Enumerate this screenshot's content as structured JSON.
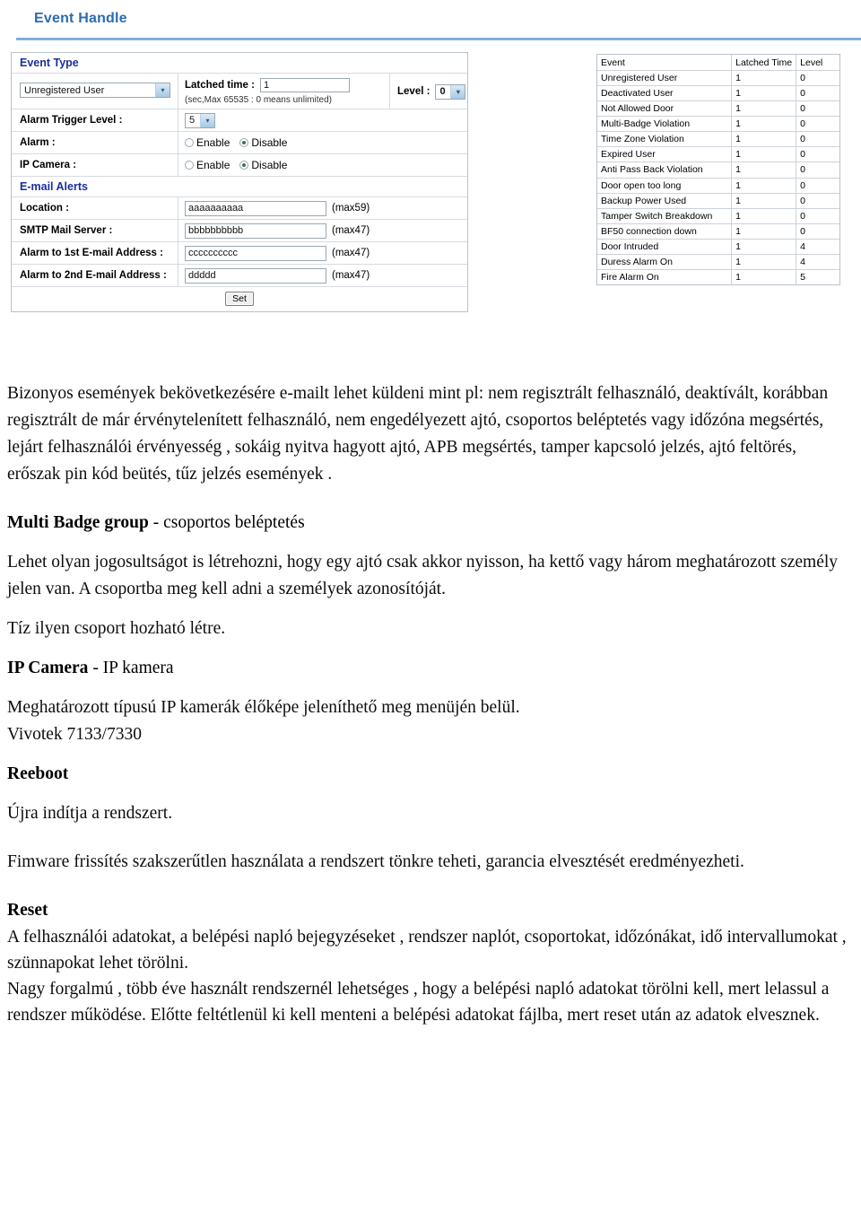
{
  "app": {
    "title": "Event Handle"
  },
  "form": {
    "event_type_section": "Event Type",
    "event_type_value": "Unregistered User",
    "latched_time_label": "Latched time :",
    "latched_time_value": "1",
    "latched_time_hint": "(sec,Max 65535 : 0 means unlimited)",
    "level_label": "Level :",
    "level_value": "0",
    "alarm_trigger_label": "Alarm Trigger Level :",
    "alarm_trigger_value": "5",
    "alarm_label": "Alarm :",
    "ip_camera_label": "IP Camera :",
    "radio_enable": "Enable",
    "radio_disable": "Disable",
    "alarm_selected": "Disable",
    "ip_camera_selected": "Disable",
    "email_section": "E-mail Alerts",
    "location_label": "Location :",
    "location_value": "aaaaaaaaaa",
    "location_max": "(max59)",
    "smtp_label": "SMTP Mail Server :",
    "smtp_value": "bbbbbbbbbb",
    "smtp_max": "(max47)",
    "email1_label": "Alarm to 1st E-mail Address :",
    "email1_value": "cccccccccc",
    "email1_max": "(max47)",
    "email2_label": "Alarm to 2nd E-mail Address :",
    "email2_value": "ddddd",
    "email2_max": "(max47)",
    "set_button": "Set"
  },
  "events_table": {
    "headers": {
      "event": "Event",
      "latched_time": "Latched Time",
      "level": "Level"
    },
    "rows": [
      {
        "event": "Unregistered User",
        "latched_time": "1",
        "level": "0"
      },
      {
        "event": "Deactivated User",
        "latched_time": "1",
        "level": "0"
      },
      {
        "event": "Not Allowed Door",
        "latched_time": "1",
        "level": "0"
      },
      {
        "event": "Multi-Badge Violation",
        "latched_time": "1",
        "level": "0"
      },
      {
        "event": "Time Zone Violation",
        "latched_time": "1",
        "level": "0"
      },
      {
        "event": "Expired User",
        "latched_time": "1",
        "level": "0"
      },
      {
        "event": "Anti Pass Back Violation",
        "latched_time": "1",
        "level": "0"
      },
      {
        "event": "Door open too long",
        "latched_time": "1",
        "level": "0"
      },
      {
        "event": "Backup Power Used",
        "latched_time": "1",
        "level": "0"
      },
      {
        "event": "Tamper Switch Breakdown",
        "latched_time": "1",
        "level": "0"
      },
      {
        "event": "BF50 connection down",
        "latched_time": "1",
        "level": "0"
      },
      {
        "event": "Door Intruded",
        "latched_time": "1",
        "level": "4"
      },
      {
        "event": "Duress Alarm On",
        "latched_time": "1",
        "level": "4"
      },
      {
        "event": "Fire Alarm On",
        "latched_time": "1",
        "level": "5"
      }
    ]
  },
  "doc": {
    "intro": "Bizonyos események bekövetkezésére e-mailt lehet küldeni  mint pl: nem regisztrált felhasználó, deaktívált, korábban regisztrált de már érvénytelenített  felhasználó, nem engedélyezett ajtó, csoportos beléptetés vagy időzóna megsértés, lejárt felhasználói érvényesség , sokáig nyitva hagyott ajtó, APB megsértés, tamper kapcsoló jelzés, ajtó feltörés, erőszak pin kód beütés, tűz jelzés események .",
    "multi_badge_heading_bold": "Multi Badge group",
    "multi_badge_heading_rest": " - csoportos beléptetés",
    "multi_badge_body": "Lehet olyan jogosultságot is létrehozni, hogy egy ajtó csak akkor nyisson, ha kettő vagy három meghatározott személy jelen van. A csoportba meg kell adni a személyek azonosítóját.",
    "multi_badge_note": "Tíz ilyen csoport hozható létre.",
    "ip_camera_heading_bold": "IP Camera",
    "ip_camera_heading_rest": "  -  IP kamera",
    "ip_camera_body": "Meghatározott típusú IP kamerák élőképe jeleníthető meg menüjén belül.",
    "ip_camera_models": "Vivotek 7133/7330",
    "reboot_heading": "Reeboot",
    "reboot_body": "Újra indítja a rendszert.",
    "firmware_warning": "Fimware frissítés szakszerűtlen használata a rendszert tönkre teheti, garancia elvesztését eredményezheti.",
    "reset_heading": "Reset",
    "reset_body1": "A felhasználói adatokat, a belépési  napló bejegyzéseket ,  rendszer naplót, csoportokat, időzónákat, idő intervallumokat , szünnapokat lehet törölni.",
    "reset_body2": "Nagy forgalmú , több éve használt rendszernél lehetséges , hogy a belépési napló adatokat törölni kell, mert lelassul a rendszer működése. Előtte feltétlenül ki kell menteni a belépési adatokat fájlba, mert reset után az adatok elvesznek."
  },
  "icons": {
    "chevron_down": "▾"
  },
  "colors": {
    "title_blue": "#2b6cb0",
    "section_blue": "#1b2f9c",
    "rule_blue": "#7fb0d9",
    "radio_dot_green": "#3a7a3a"
  }
}
